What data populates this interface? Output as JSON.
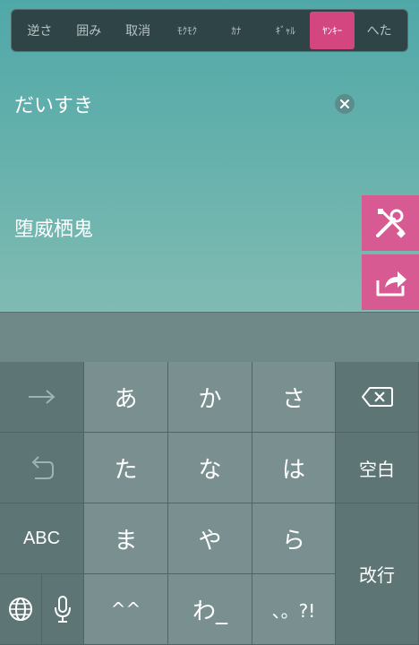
{
  "style_tabs": [
    {
      "label": "逆さ",
      "active": false
    },
    {
      "label": "囲み",
      "active": false
    },
    {
      "label": "取消",
      "active": false
    },
    {
      "label": "ﾓｸﾓｸ",
      "active": false
    },
    {
      "label": "ｶﾅ",
      "active": false
    },
    {
      "label": "ｷﾞｬﾙ",
      "active": false
    },
    {
      "label": "ﾔﾝｷｰ",
      "active": true
    },
    {
      "label": "へた",
      "active": false
    }
  ],
  "input": {
    "value": "だいすき"
  },
  "output": {
    "value": "堕威栖鬼"
  },
  "keyboard": {
    "row1": [
      "あ",
      "か",
      "さ"
    ],
    "row2": [
      "た",
      "な",
      "は"
    ],
    "row3": [
      "ま",
      "や",
      "ら"
    ],
    "row4": [
      "^^",
      "わ_",
      "、。?!"
    ],
    "abc": "ABC",
    "space": "空白",
    "return": "改行"
  },
  "colors": {
    "accent": "#d3467f",
    "side_button": "#d85a92",
    "bar_bg": "#2f4447"
  }
}
